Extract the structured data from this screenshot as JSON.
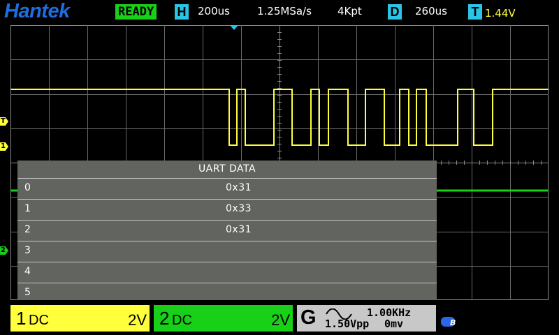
{
  "header": {
    "logo": "Hantek",
    "status": "READY",
    "horizontal_tag": "H",
    "timebase": "200us",
    "sample_rate": "1.25MSa/s",
    "memory_depth": "4Kpt",
    "delay_tag": "D",
    "delay": "260us",
    "trigger_tag": "T",
    "trigger_level": "1.44V"
  },
  "decode": {
    "title": "UART DATA",
    "rows": [
      {
        "index": "0",
        "value": "0x31"
      },
      {
        "index": "1",
        "value": "0x33"
      },
      {
        "index": "2",
        "value": "0x31"
      },
      {
        "index": "3",
        "value": ""
      },
      {
        "index": "4",
        "value": ""
      },
      {
        "index": "5",
        "value": ""
      }
    ]
  },
  "markers": {
    "trigger": "T",
    "ch1": "1",
    "ch2": "2"
  },
  "channels": {
    "ch1": {
      "number": "1",
      "coupling": "DC",
      "scale": "2V",
      "color": "#ffff3c"
    },
    "ch2": {
      "number": "2",
      "coupling": "DC",
      "scale": "2V",
      "color": "#18d018"
    }
  },
  "generator": {
    "label": "G",
    "waveform_icon": "sine-wave-icon",
    "frequency": "1.00KHz",
    "amplitude": "1.50Vpp",
    "offset": "0mv"
  },
  "status_icons": {
    "usb": "usb-icon"
  },
  "colors": {
    "ch1": "#ffff3c",
    "ch2": "#18d018",
    "accent": "#29c5e6",
    "logo": "#1e6ee0",
    "trigger_pointer": "#29c5e6"
  }
}
